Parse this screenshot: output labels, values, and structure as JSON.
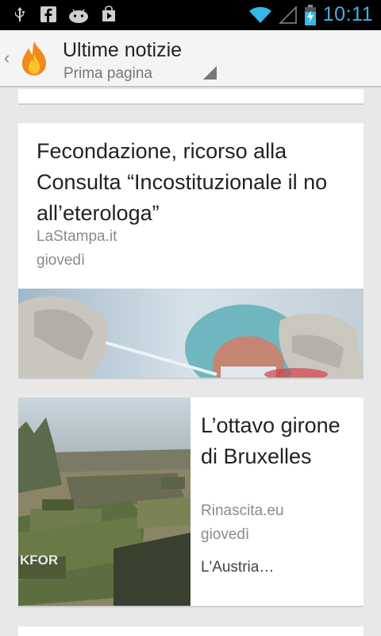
{
  "status_bar": {
    "time": "10:11",
    "icons": [
      "usb-icon",
      "facebook-icon",
      "android-icon",
      "play-store-icon",
      "wifi-icon",
      "signal-icon",
      "battery-charging-icon"
    ],
    "clock_color": "#37b5e5"
  },
  "action_bar": {
    "title": "Ultime notizie",
    "subtitle": "Prima pagina",
    "icon": "flame-icon"
  },
  "articles": [
    {
      "headline": "Fecondazione, ricorso alla Consulta “Incostituzionale il no all’eterologa”",
      "source": "LaStampa.it",
      "date": "giovedì",
      "image": "lab-researcher-photo"
    },
    {
      "headline": "L’ottavo girone di Bruxelles",
      "source": "Rinascita.eu",
      "date": "giovedì",
      "snippet": "L'Austria…",
      "image": "military-vehicles-photo"
    }
  ]
}
